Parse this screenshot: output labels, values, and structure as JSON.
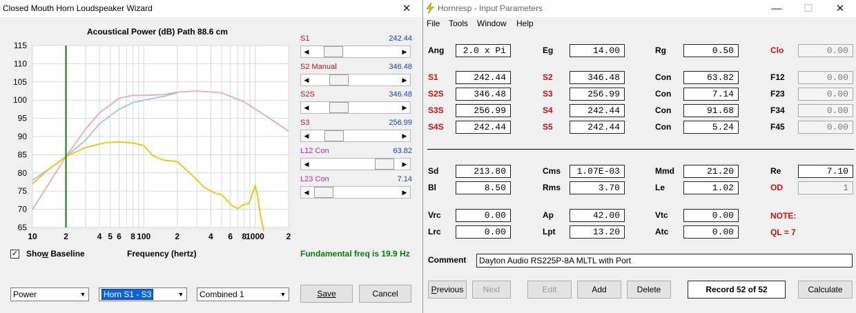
{
  "left_window": {
    "title": "Closed Mouth Horn Loudspeaker Wizard",
    "close_glyph": "✕",
    "plot": {
      "title": "Acoustical Power (dB)   Path 88.6 cm",
      "y_ticks": [
        "115",
        "110",
        "105",
        "100",
        "95",
        "90",
        "85",
        "80",
        "75",
        "70",
        "65"
      ],
      "x_ticks": [
        "10",
        "2",
        "4",
        "5",
        "6",
        "8",
        "100",
        "2",
        "4",
        "6",
        "8",
        "1000",
        "2"
      ],
      "xlabel": "Frequency (hertz)"
    },
    "sliders": [
      {
        "label": "S1",
        "value": "242.44",
        "label_color": "#cc1010",
        "thumb_pos": 0.18
      },
      {
        "label": "S2  Manual",
        "value": "346.48",
        "label_color": "#cc1010",
        "thumb_pos": 0.26
      },
      {
        "label": "S2S",
        "value": "346.48",
        "label_color": "#cc1010",
        "thumb_pos": 0.26
      },
      {
        "label": "S3",
        "value": "256.99",
        "label_color": "#cc1010",
        "thumb_pos": 0.19
      },
      {
        "label": "L12  Con",
        "value": "63.82",
        "label_color": "#c020c0",
        "thumb_pos": 0.92
      },
      {
        "label": "L23  Con",
        "value": "7.14",
        "label_color": "#c020c0",
        "thumb_pos": 0.04
      }
    ],
    "show_baseline": {
      "checked": true,
      "check_glyph": "✓",
      "label": "Show Baseline"
    },
    "fundamental": "Fundamental freq is 19.9 Hz",
    "combos": {
      "power": "Power",
      "horn": "Horn S1 - S3",
      "combined": "Combined 1"
    },
    "buttons": {
      "save": "Save",
      "cancel": "Cancel"
    }
  },
  "right_window": {
    "title": "Hornresp - Input Parameters",
    "app_icon_color": "#e8c800",
    "menu": [
      "File",
      "Tools",
      "Window",
      "Help"
    ],
    "controls": {
      "minimize": "—",
      "maximize": "☐",
      "close": "✕"
    },
    "rows1": [
      [
        {
          "l": "Ang",
          "v": "2.0 x Pi",
          "c": "black"
        },
        {
          "l": "Eg",
          "v": "14.00",
          "c": "black"
        },
        {
          "l": "Rg",
          "v": "0.50",
          "c": "black"
        },
        {
          "l": "Clo",
          "v": "0.00",
          "c": "red",
          "ro": true
        }
      ],
      [
        {
          "l": "S1",
          "v": "242.44",
          "c": "red"
        },
        {
          "l": "S2",
          "v": "346.48",
          "c": "red"
        },
        {
          "l": "Con",
          "v": "63.82",
          "c": "black"
        },
        {
          "l": "F12",
          "v": "0.00",
          "c": "black",
          "ro": true
        }
      ],
      [
        {
          "l": "S2S",
          "v": "346.48",
          "c": "red"
        },
        {
          "l": "S3",
          "v": "256.99",
          "c": "red"
        },
        {
          "l": "Con",
          "v": "7.14",
          "c": "black"
        },
        {
          "l": "F23",
          "v": "0.00",
          "c": "black",
          "ro": true
        }
      ],
      [
        {
          "l": "S3S",
          "v": "256.99",
          "c": "red"
        },
        {
          "l": "S4",
          "v": "242.44",
          "c": "red"
        },
        {
          "l": "Con",
          "v": "91.68",
          "c": "black"
        },
        {
          "l": "F34",
          "v": "0.00",
          "c": "black",
          "ro": true
        }
      ],
      [
        {
          "l": "S4S",
          "v": "242.44",
          "c": "red"
        },
        {
          "l": "S5",
          "v": "242.44",
          "c": "red"
        },
        {
          "l": "Con",
          "v": "5.24",
          "c": "black"
        },
        {
          "l": "F45",
          "v": "0.00",
          "c": "black",
          "ro": true
        }
      ]
    ],
    "rows2": [
      [
        {
          "l": "Sd",
          "v": "213.80",
          "c": "black"
        },
        {
          "l": "Cms",
          "v": "1.07E-03",
          "c": "black"
        },
        {
          "l": "Mmd",
          "v": "21.20",
          "c": "black"
        },
        {
          "l": "Re",
          "v": "7.10",
          "c": "black"
        }
      ],
      [
        {
          "l": "Bl",
          "v": "8.50",
          "c": "black"
        },
        {
          "l": "Rms",
          "v": "3.70",
          "c": "black"
        },
        {
          "l": "Le",
          "v": "1.02",
          "c": "black"
        },
        {
          "l": "OD",
          "v": "1",
          "c": "red",
          "ro": true
        }
      ]
    ],
    "rows3": [
      [
        {
          "l": "Vrc",
          "v": "0.00",
          "c": "black"
        },
        {
          "l": "Ap",
          "v": "42.00",
          "c": "black"
        },
        {
          "l": "Vtc",
          "v": "0.00",
          "c": "black"
        }
      ],
      [
        {
          "l": "Lrc",
          "v": "0.00",
          "c": "black"
        },
        {
          "l": "Lpt",
          "v": "13.20",
          "c": "black"
        },
        {
          "l": "Atc",
          "v": "0.00",
          "c": "black"
        }
      ]
    ],
    "note": {
      "label": "NOTE:",
      "text": "QL = 7"
    },
    "comment": {
      "label": "Comment",
      "value": "Dayton Audio RS225P-8A MLTL with Port"
    },
    "buttons": {
      "previous": "Previous",
      "next": "Next",
      "edit": "Edit",
      "add": "Add",
      "delete": "Delete",
      "record": "Record 52 of 52",
      "calculate": "Calculate"
    }
  }
}
